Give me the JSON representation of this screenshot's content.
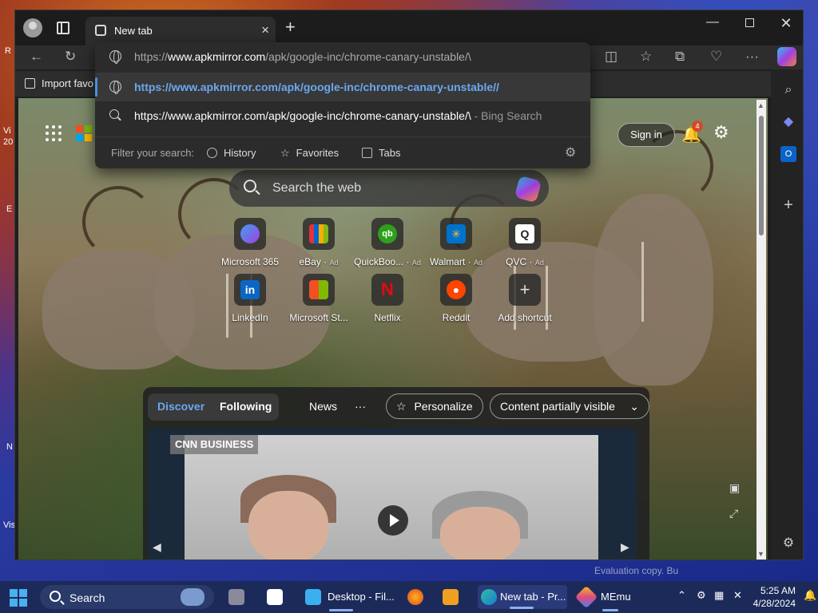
{
  "desktop": {
    "labels": [
      "R",
      "Vi",
      "20",
      "E",
      "N",
      "Vis"
    ]
  },
  "tab": {
    "title": "New tab"
  },
  "bookmarks": {
    "import_label": "Import favo"
  },
  "address_dropdown": {
    "typed_url_prefix": "https://",
    "typed_url_host": "www.apkmirror.com",
    "typed_url_path": "/apk/google-inc/chrome-canary-unstable/\\",
    "suggestion_url": "https://www.apkmirror.com/apk/google-inc/chrome-canary-unstable//",
    "search_text": "https://www.apkmirror.com/apk/google-inc/chrome-canary-unstable/\\",
    "search_suffix": " - Bing Search",
    "filter_label": "Filter your search:",
    "filters": [
      "History",
      "Favorites",
      "Tabs"
    ]
  },
  "ntp": {
    "signin_label": "Sign in",
    "notification_count": "4",
    "search_placeholder": "Search the web",
    "shortcuts": [
      {
        "label": "Microsoft 365",
        "ad": "",
        "color": "#5a3ad0",
        "glyph": ""
      },
      {
        "label": "eBay",
        "ad": "Ad",
        "color": "#2a2a2a",
        "glyph": ""
      },
      {
        "label": "QuickBoo...",
        "ad": "Ad",
        "color": "#2ca01c",
        "glyph": "qb"
      },
      {
        "label": "Walmart",
        "ad": "Ad",
        "color": "#0071ce",
        "glyph": "✳"
      },
      {
        "label": "QVC",
        "ad": "Ad",
        "color": "#ffffff",
        "glyph": "Q"
      },
      {
        "label": "LinkedIn",
        "ad": "",
        "color": "#0a66c2",
        "glyph": "in"
      },
      {
        "label": "Microsoft St...",
        "ad": "",
        "color": "#3a3a3a",
        "glyph": ""
      },
      {
        "label": "Netflix",
        "ad": "",
        "color": "#1a1a1a",
        "glyph": "N"
      },
      {
        "label": "Reddit",
        "ad": "",
        "color": "#ff4500",
        "glyph": "●"
      },
      {
        "label": "Add shortcut",
        "ad": "",
        "color": "#555555",
        "glyph": "+"
      }
    ],
    "feed": {
      "tabs": [
        "Discover",
        "Following"
      ],
      "news_label": "News",
      "more_label": "···",
      "personalize_label": "Personalize",
      "visibility_label": "Content partially visible",
      "video_logo": "CNN BUSINESS"
    }
  },
  "taskbar": {
    "search_label": "Search",
    "apps": [
      {
        "label": "Desktop - Fil...",
        "color": "#3ab0f0"
      },
      {
        "label": "New tab - Pr...",
        "color": "#1a8ad0"
      },
      {
        "label": "MEmu",
        "color": "#e0a020"
      }
    ],
    "time": "5:25 AM",
    "date": "4/28/2024",
    "watermark": "Evaluation copy. Bu"
  }
}
